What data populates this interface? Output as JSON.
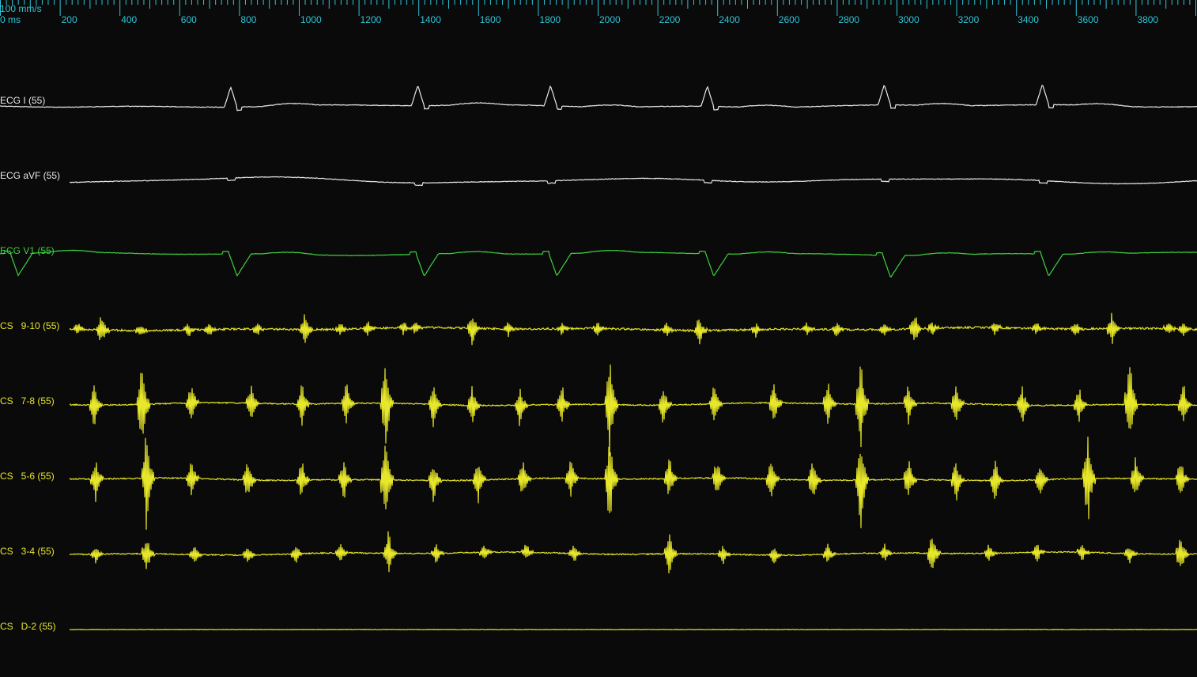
{
  "header": {
    "speed_label": "100 mm/s",
    "zero_label": "0 ms",
    "time_ticks_ms": [
      200,
      400,
      600,
      800,
      1000,
      1200,
      1400,
      1600,
      1800,
      2000,
      2200,
      2400,
      2600,
      2800,
      3000,
      3200,
      3400,
      3600,
      3800
    ],
    "ruler_color": "#2ec4d6"
  },
  "channels": [
    {
      "id": "ecg-i",
      "label": "ECG I (55)",
      "color": "#e8e8e8",
      "type": "ecg_qrs_up",
      "beat_times_ms": [
        772,
        1398,
        1842,
        2367,
        2959,
        3488
      ]
    },
    {
      "id": "ecg-avf",
      "label": "ECG aVF (55)",
      "color": "#e8e8e8",
      "type": "flat_wavy",
      "beat_times_ms": [
        772,
        1398,
        1842,
        2367,
        2959,
        3488
      ]
    },
    {
      "id": "ecg-v1",
      "label": "ECG V1 (55)",
      "color": "#3ed13e",
      "type": "ecg_qrs_down",
      "beat_times_ms": [
        40,
        772,
        1398,
        1842,
        2367,
        2959,
        3488
      ]
    },
    {
      "id": "cs-9-10",
      "label": "CS   9-10 (55)",
      "color": "#e6e62a",
      "type": "egm_small",
      "spike_times_ms": [
        120,
        260,
        340,
        470,
        630,
        700,
        860,
        1020,
        1140,
        1230,
        1350,
        1390,
        1580,
        1700,
        1880,
        2000,
        2230,
        2340,
        2530,
        2700,
        2800,
        2960,
        3060,
        3120,
        3330,
        3470,
        3600,
        3720,
        3910,
        3960
      ]
    },
    {
      "id": "cs-7-8",
      "label": "CS   7-8 (55)",
      "color": "#e6e62a",
      "type": "egm_large",
      "spike_times_ms": [
        150,
        315,
        475,
        640,
        840,
        1010,
        1160,
        1290,
        1450,
        1580,
        1740,
        1880,
        2040,
        2220,
        2390,
        2590,
        2770,
        2880,
        3040,
        3200,
        3420,
        3610,
        3780,
        3960
      ]
    },
    {
      "id": "cs-5-6",
      "label": "CS   5-6 (55)",
      "color": "#e6e62a",
      "type": "egm_large",
      "spike_times_ms": [
        150,
        320,
        490,
        640,
        830,
        1010,
        1150,
        1290,
        1450,
        1600,
        1750,
        1910,
        2040,
        2240,
        2400,
        2580,
        2720,
        2880,
        3040,
        3200,
        3330,
        3480,
        3640,
        3800,
        3950
      ]
    },
    {
      "id": "cs-3-4",
      "label": "CS   3-4 (55)",
      "color": "#e6e62a",
      "type": "egm_medium",
      "spike_times_ms": [
        160,
        320,
        490,
        650,
        830,
        990,
        1140,
        1300,
        1460,
        1620,
        1760,
        1920,
        2240,
        2420,
        2590,
        2770,
        2960,
        3120,
        3310,
        3470,
        3620,
        3780,
        3950
      ]
    },
    {
      "id": "cs-d-2",
      "label": "CS   D-2 (55)",
      "color": "#e6e62a",
      "type": "flat",
      "beat_times_ms": []
    }
  ]
}
